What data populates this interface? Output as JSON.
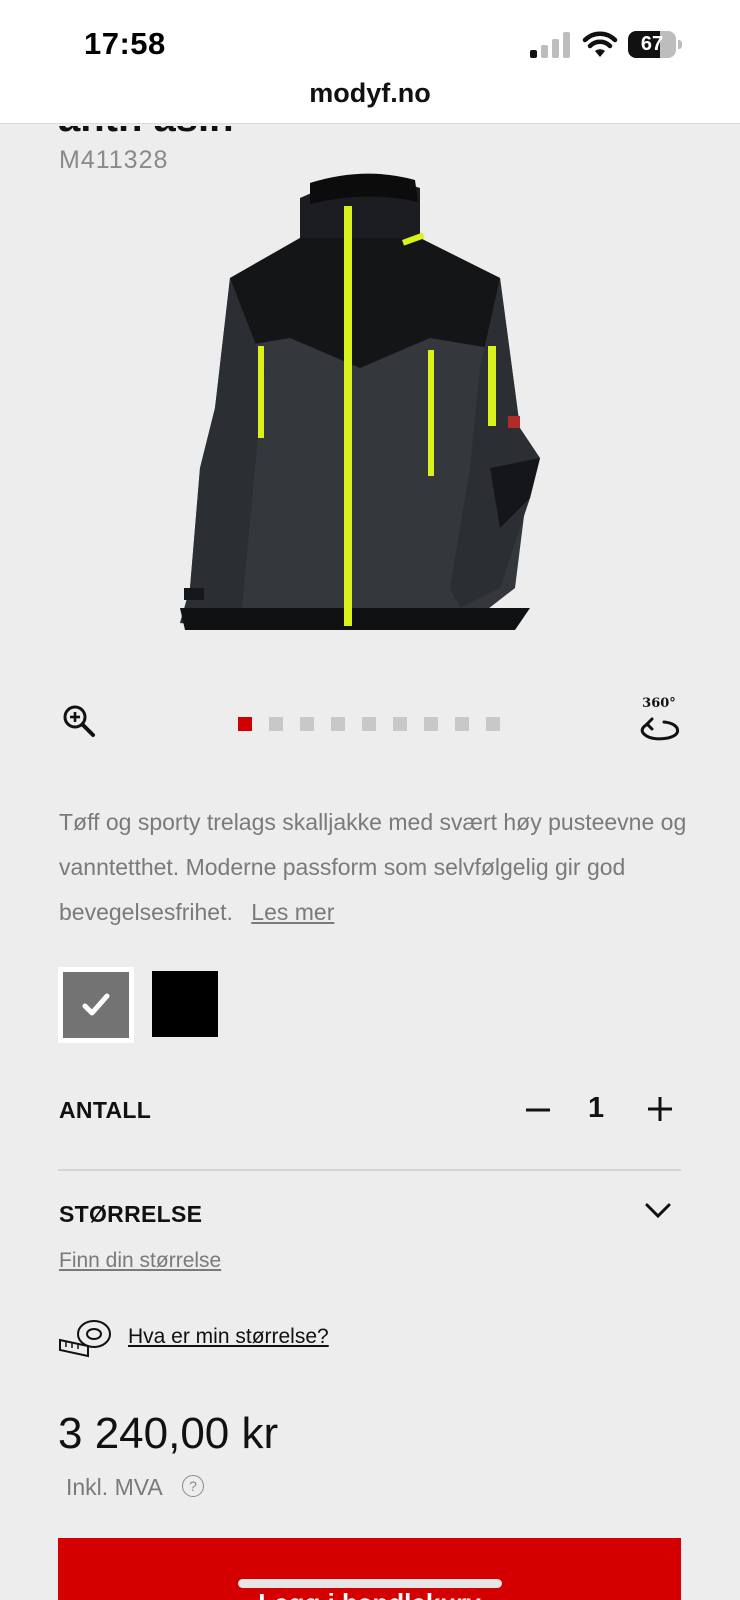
{
  "status_bar": {
    "time": "17:58",
    "battery_percent": "67",
    "battery_level": 0.67
  },
  "browser": {
    "url": "modyf.no"
  },
  "product": {
    "title_clipped": "anth asin",
    "sku": "M411328",
    "image_icon": "softshell-jacket-image",
    "gallery": {
      "count": 9,
      "active_index": 0,
      "active_color": "#d00000",
      "inactive_color": "#c8c8c8"
    },
    "rotate_label": "360°",
    "description": "Tøff og sporty trelags skalljakke med svært høy pusteevne og vanntetthet. Moderne passform som selvfølgelig gir god bevegelsesfrihet.",
    "read_more": "Les mer",
    "colors": [
      {
        "name": "grey",
        "hex": "#737373",
        "selected": true
      },
      {
        "name": "black",
        "hex": "#000000",
        "selected": false
      }
    ]
  },
  "quantity": {
    "label": "ANTALL",
    "value": "1"
  },
  "size": {
    "label": "STØRRELSE",
    "find_link": "Finn din størrelse",
    "help_link": "Hva er min størrelse?"
  },
  "pricing": {
    "price": "3 240,00 kr",
    "vat_note": "Inkl. MVA",
    "help_glyph": "?"
  },
  "cta": {
    "label": "Legg i handlekurv",
    "color": "#d40000"
  }
}
